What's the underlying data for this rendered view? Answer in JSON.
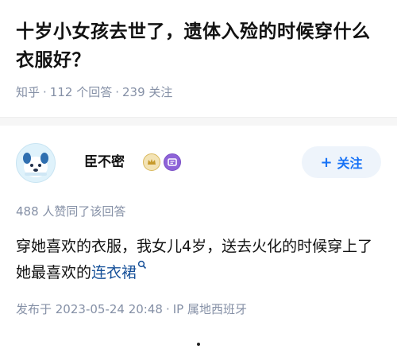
{
  "question": {
    "title": "十岁小女孩去世了，遗体入殓的时候穿什么衣服好？",
    "site": "知乎",
    "answers_count": "112 个回答",
    "followers": "239 关注"
  },
  "author": {
    "name": "臣不密",
    "avatar_icon": "dog-avatar-icon",
    "badges": [
      "crown-badge-icon",
      "message-badge-icon"
    ],
    "follow_label": "关注"
  },
  "answer": {
    "voteup": "488 人赞同了该回答",
    "text_before": "穿她喜欢的衣服，我女儿4岁，送去火化的时候穿上了她最喜欢的",
    "link_term": "连衣裙",
    "posted_at": "发布于 2023-05-24 20:48",
    "ip_location": "IP 属地西班牙"
  },
  "colors": {
    "link": "#175199",
    "accent": "#1772f6",
    "meta_gray": "#8590a6"
  }
}
